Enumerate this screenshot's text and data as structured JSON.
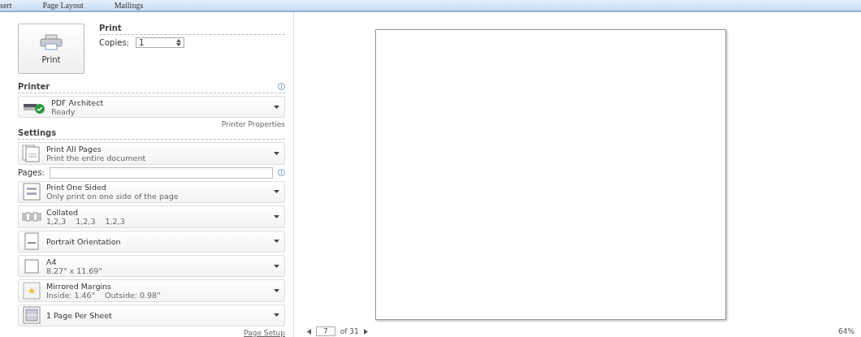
{
  "ribbon_tabs": [
    {
      "label": "sert",
      "selected": false
    },
    {
      "label": "Page Layout",
      "selected": false
    },
    {
      "label": "Mailings",
      "selected": false
    }
  ],
  "print_button": {
    "label": "Print"
  },
  "print_section": {
    "title": "Print",
    "copies_label": "Copies:",
    "copies_value": "1"
  },
  "printer": {
    "title": "Printer",
    "name": "PDF Architect",
    "status": "Ready",
    "properties_link": "Printer Properties"
  },
  "settings": {
    "title": "Settings",
    "pages_label": "Pages:",
    "page_setup_link": "Page Setup",
    "items": [
      {
        "kind": "pages",
        "title": "Print All Pages",
        "subtitle": "Print the entire document"
      },
      {
        "kind": "sides",
        "title": "Print One Sided",
        "subtitle": "Only print on one side of the page"
      },
      {
        "kind": "collate",
        "title": "Collated",
        "subtitle": "1,2,3    1,2,3    1,2,3"
      },
      {
        "kind": "orientation",
        "title": "Portrait Orientation"
      },
      {
        "kind": "paper",
        "title": "A4",
        "subtitle": "8.27\" x 11.69\""
      },
      {
        "kind": "margins",
        "title": "Mirrored Margins",
        "subtitle": "Inside: 1.46\"    Outside: 0.98\""
      },
      {
        "kind": "persheet",
        "title": "1 Page Per Sheet"
      }
    ]
  },
  "preview": {
    "page_number": "7",
    "page_total": "of 31",
    "zoom": "64%"
  }
}
